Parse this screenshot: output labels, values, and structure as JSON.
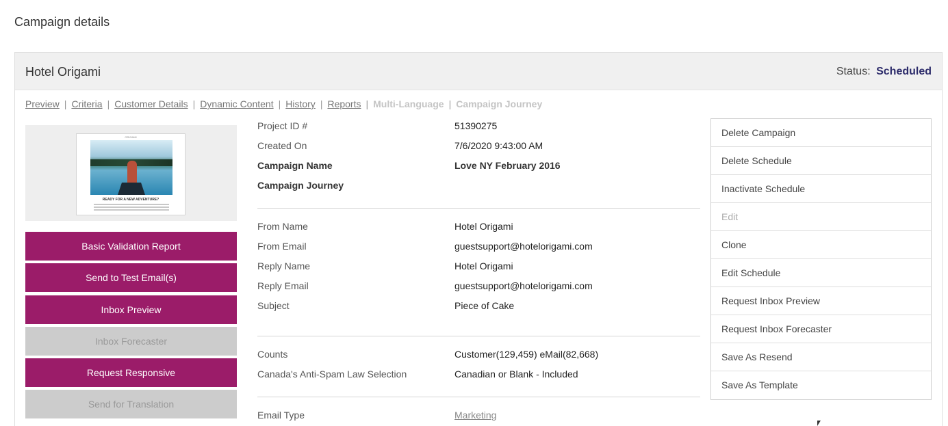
{
  "page": {
    "title": "Campaign details"
  },
  "panel": {
    "name": "Hotel Origami",
    "status_label": "Status:",
    "status_value": "Scheduled"
  },
  "tabs": [
    {
      "label": "Preview",
      "enabled": true
    },
    {
      "label": "Criteria",
      "enabled": true
    },
    {
      "label": "Customer Details",
      "enabled": true
    },
    {
      "label": "Dynamic Content",
      "enabled": true
    },
    {
      "label": "History",
      "enabled": true
    },
    {
      "label": "Reports",
      "enabled": true
    },
    {
      "label": "Multi-Language",
      "enabled": false
    },
    {
      "label": "Campaign Journey",
      "enabled": false
    }
  ],
  "thumbnail": {
    "logo": "ORIGAMI",
    "headline": "READY FOR A NEW ADVENTURE?"
  },
  "actions": [
    {
      "label": "Basic Validation Report",
      "enabled": true
    },
    {
      "label": "Send to Test Email(s)",
      "enabled": true
    },
    {
      "label": "Inbox Preview",
      "enabled": true
    },
    {
      "label": "Inbox Forecaster",
      "enabled": false
    },
    {
      "label": "Request Responsive",
      "enabled": true
    },
    {
      "label": "Send for Translation",
      "enabled": false
    }
  ],
  "details": {
    "project_id": {
      "label": "Project ID #",
      "value": "51390275"
    },
    "created_on": {
      "label": "Created On",
      "value": "7/6/2020 9:43:00 AM"
    },
    "campaign_name": {
      "label": "Campaign Name",
      "value": "Love NY February 2016"
    },
    "campaign_journey": {
      "label": "Campaign Journey",
      "value": ""
    },
    "from_name": {
      "label": "From Name",
      "value": "Hotel Origami"
    },
    "from_email": {
      "label": "From Email",
      "value": "guestsupport@hotelorigami.com"
    },
    "reply_name": {
      "label": "Reply Name",
      "value": "Hotel Origami"
    },
    "reply_email": {
      "label": "Reply Email",
      "value": "guestsupport@hotelorigami.com"
    },
    "subject": {
      "label": "Subject",
      "value": "Piece of Cake"
    },
    "counts": {
      "label": "Counts",
      "value": "Customer(129,459) eMail(82,668)"
    },
    "casl": {
      "label": "Canada's Anti-Spam Law Selection",
      "value": "Canadian or Blank - Included"
    },
    "email_type": {
      "label": "Email Type",
      "value": "Marketing"
    }
  },
  "side_menu": [
    {
      "label": "Delete Campaign",
      "enabled": true
    },
    {
      "label": "Delete Schedule",
      "enabled": true
    },
    {
      "label": "Inactivate Schedule",
      "enabled": true
    },
    {
      "label": "Edit",
      "enabled": false
    },
    {
      "label": "Clone",
      "enabled": true
    },
    {
      "label": "Edit Schedule",
      "enabled": true
    },
    {
      "label": "Request Inbox Preview",
      "enabled": true
    },
    {
      "label": "Request Inbox Forecaster",
      "enabled": true
    },
    {
      "label": "Save As Resend",
      "enabled": true
    },
    {
      "label": "Save As Template",
      "enabled": true
    }
  ],
  "colors": {
    "accent": "#9b1c69",
    "status": "#2c2b6a",
    "disabled": "#cccccc"
  }
}
